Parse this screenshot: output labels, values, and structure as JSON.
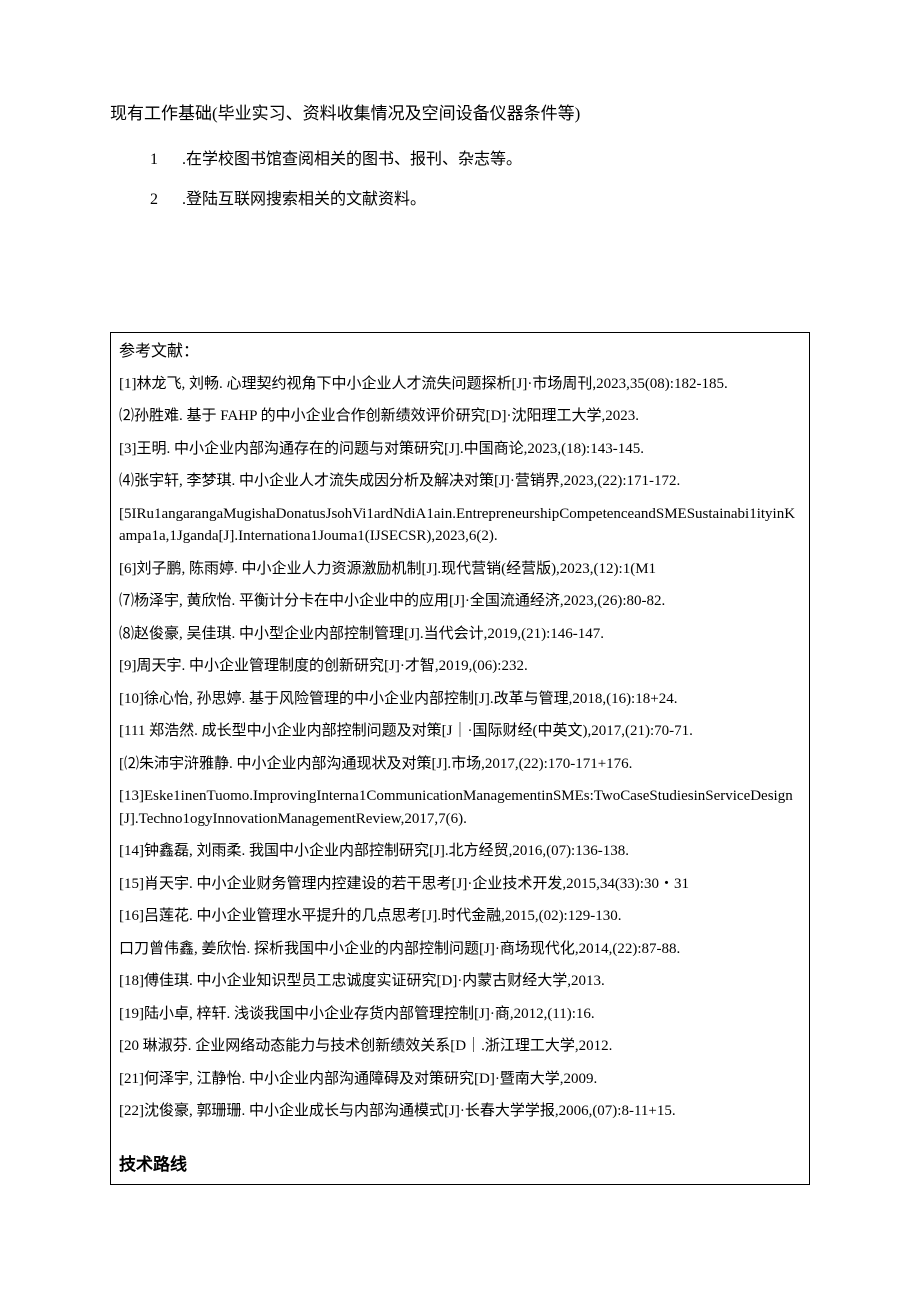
{
  "topSection": {
    "title": "现有工作基础(毕业实习、资料收集情况及空间设备仪器条件等)",
    "items": [
      {
        "num": "1",
        "text": ".在学校图书馆查阅相关的图书、报刊、杂志等。"
      },
      {
        "num": "2",
        "text": ".登陆互联网搜索相关的文献资料。"
      }
    ]
  },
  "references": {
    "title": "参考文献：",
    "items": [
      "[1]林龙飞, 刘畅. 心理契约视角下中小企业人才流失问题探析[J]·市场周刊,2023,35(08):182-185.",
      "⑵孙胜难. 基于 FAHP 的中小企业合作创新绩效评价研究[D]·沈阳理工大学,2023.",
      "[3]王明. 中小企业内部沟通存在的问题与对策研究[J].中国商论,2023,(18):143-145.",
      "⑷张宇轩, 李梦琪. 中小企业人才流失成因分析及解决对策[J]·营销界,2023,(22):171-172.",
      "[5IRu1angarangaMugishaDonatusJsohVi1ardNdiA1ain.EntrepreneurshipCompetenceandSMESustainabi1ityinKampa1a,1Jganda[J].Internationa1Jouma1(IJSECSR),2023,6(2).",
      "[6]刘子鹏, 陈雨婷. 中小企业人力资源激励机制[J].现代营销(经营版),2023,(12):1(M1",
      "⑺杨泽宇, 黄欣怡. 平衡计分卡在中小企业中的应用[J]·全国流通经济,2023,(26):80-82.",
      "⑻赵俊豪, 吴佳琪. 中小型企业内部控制管理[J].当代会计,2019,(21):146-147.",
      "[9]周天宇. 中小企业管理制度的创新研究[J]·才智,2019,(06):232.",
      "[10]徐心怡, 孙思婷. 基于风险管理的中小企业内部控制[J].改革与管理,2018,(16):18+24.",
      "[111 郑浩然. 成长型中小企业内部控制问题及对策[J｜·国际财经(中英文),2017,(21):70-71.",
      "[⑵朱沛宇浒雅静. 中小企业内部沟通现状及对策[J].市场,2017,(22):170-171+176.",
      "[13]Eske1inenTuomo.ImprovingInterna1CommunicationManagementinSMEs:TwoCaseStudiesinServiceDesign[J].Techno1ogyInnovationManagementReview,2017,7(6).",
      "[14]钟鑫磊, 刘雨柔. 我国中小企业内部控制研究[J].北方经贸,2016,(07):136-138.",
      "[15]肖天宇. 中小企业财务管理内控建设的若干思考[J]·企业技术开发,2015,34(33):30・31",
      "[16]吕莲花. 中小企业管理水平提升的几点思考[J].时代金融,2015,(02):129-130.",
      "口刀曾伟鑫, 姜欣怡. 探析我国中小企业的内部控制问题[J]·商场现代化,2014,(22):87-88.",
      "[18]傅佳琪. 中小企业知识型员工忠诚度实证研究[D]·内蒙古财经大学,2013.",
      "[19]陆小卓, 梓轩. 浅谈我国中小企业存货内部管理控制[J]·商,2012,(11):16.",
      "[20 琳淑芬. 企业网络动态能力与技术创新绩效关系[D｜.浙江理工大学,2012.",
      "[21]何泽宇, 江静怡. 中小企业内部沟通障碍及对策研究[D]·暨南大学,2009.",
      "[22]沈俊豪, 郭珊珊. 中小企业成长与内部沟通模式[J]·长春大学学报,2006,(07):8-11+15."
    ],
    "techRoute": "技术路线"
  }
}
